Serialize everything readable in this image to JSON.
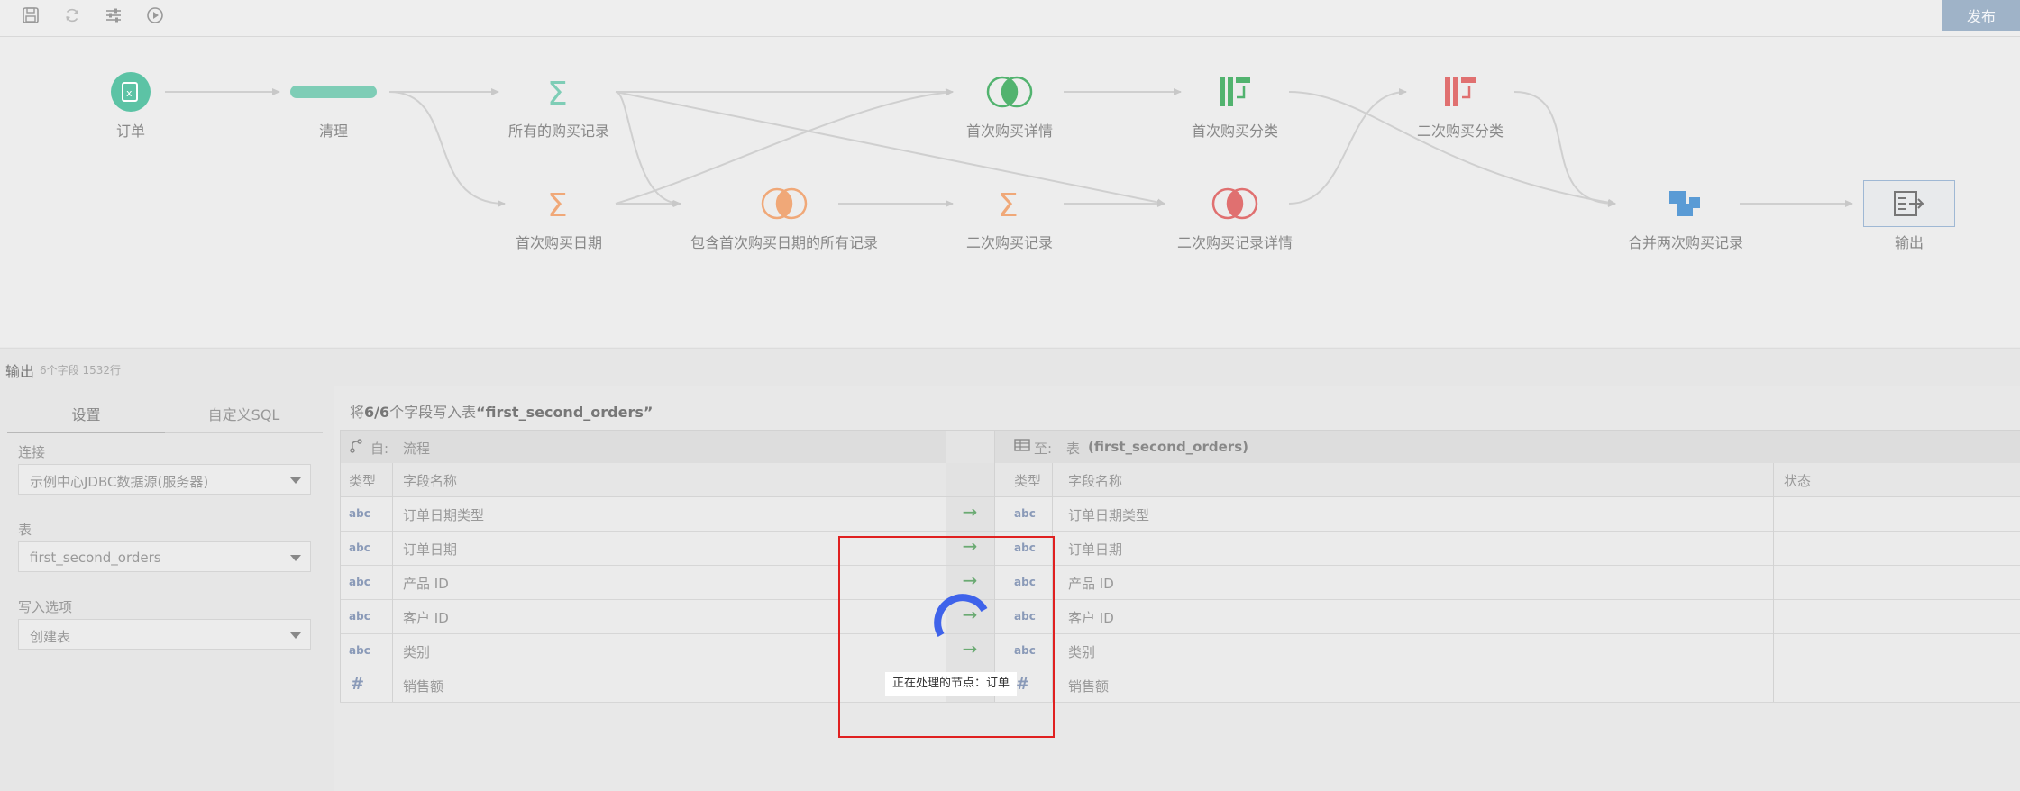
{
  "toolbar": {
    "icons": [
      "save-icon",
      "refresh-icon",
      "settings-sliders-icon",
      "play-icon"
    ],
    "publish_label": "发布"
  },
  "flow": {
    "nodes": {
      "orders": "订单",
      "clean": "清理",
      "all_purchases": "所有的购买记录",
      "first_purchase_date": "首次购买日期",
      "all_with_first_date": "包含首次购买日期的所有记录",
      "first_purchase_detail": "首次购买详情",
      "second_purchase_record": "二次购买记录",
      "first_purchase_category": "首次购买分类",
      "second_purchase_detail": "二次购买记录详情",
      "second_purchase_category": "二次购买分类",
      "merge_two": "合并两次购买记录",
      "output": "输出"
    }
  },
  "output_header": {
    "title": "输出",
    "meta": "6个字段 1532行"
  },
  "left": {
    "tabs": [
      "设置",
      "自定义SQL"
    ],
    "connection_label": "连接",
    "connection_value": "示例中心JDBC数据源(服务器)",
    "table_label": "表",
    "table_value": "first_second_orders",
    "write_option_label": "写入选项",
    "write_option_value": "创建表"
  },
  "right": {
    "title_prefix": "将",
    "title_count": "6/6",
    "title_middle": "个字段写入表",
    "title_table": "“first_second_orders”",
    "from_label": "自:",
    "from_value": "流程",
    "to_label": "至:",
    "to_kind": "表",
    "to_value": "(first_second_orders)",
    "col_type": "类型",
    "col_field": "字段名称",
    "col_status": "状态",
    "rows": [
      {
        "type": "abc",
        "src": "订单日期类型",
        "dst": "订单日期类型"
      },
      {
        "type": "abc",
        "src": "订单日期",
        "dst": "订单日期"
      },
      {
        "type": "abc",
        "src": "产品 ID",
        "dst": "产品 ID"
      },
      {
        "type": "abc",
        "src": "客户 ID",
        "dst": "客户 ID"
      },
      {
        "type": "abc",
        "src": "类别",
        "dst": "类别"
      },
      {
        "type": "#",
        "src": "销售额",
        "dst": "销售额"
      }
    ]
  },
  "overlay": {
    "busy_text": "正在处理的节点：订单"
  },
  "colors": {
    "accent_blue": "#3f63ea",
    "teal": "#5cc3a5",
    "green": "#52b36f",
    "orange": "#f0a878",
    "red": "#e07070",
    "blue_node": "#5a9bd5",
    "highlight_red": "#e02020"
  }
}
